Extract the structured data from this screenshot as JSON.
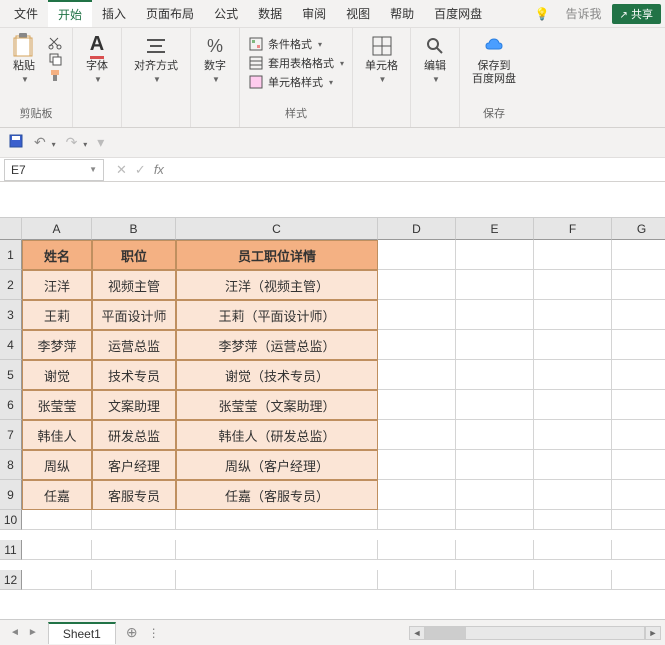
{
  "menu": {
    "file": "文件",
    "home": "开始",
    "insert": "插入",
    "layout": "页面布局",
    "formula": "公式",
    "data": "数据",
    "review": "审阅",
    "view": "视图",
    "help": "帮助",
    "baidu": "百度网盘",
    "tellme": "告诉我",
    "share": "共享"
  },
  "ribbon": {
    "clipboard": {
      "paste": "粘贴",
      "label": "剪贴板"
    },
    "font": {
      "btn": "字体"
    },
    "align": {
      "btn": "对齐方式"
    },
    "number": {
      "btn": "数字"
    },
    "styles": {
      "cond": "条件格式",
      "tbl": "套用表格格式",
      "cell": "单元格样式",
      "label": "样式"
    },
    "cells": {
      "btn": "单元格"
    },
    "editing": {
      "btn": "编辑"
    },
    "save": {
      "btn": "保存到\n百度网盘",
      "label": "保存"
    }
  },
  "namebox": "E7",
  "cols": [
    "A",
    "B",
    "C",
    "D",
    "E",
    "F",
    "G"
  ],
  "rows": [
    "1",
    "2",
    "3",
    "4",
    "5",
    "6",
    "7",
    "8",
    "9",
    "10",
    "11",
    "12"
  ],
  "header": {
    "a": "姓名",
    "b": "职位",
    "c": "员工职位详情"
  },
  "data": [
    {
      "a": "汪洋",
      "b": "视频主管",
      "c": "汪洋（视频主管）"
    },
    {
      "a": "王莉",
      "b": "平面设计师",
      "c": "王莉（平面设计师）"
    },
    {
      "a": "李梦萍",
      "b": "运营总监",
      "c": "李梦萍（运营总监）"
    },
    {
      "a": "谢觉",
      "b": "技术专员",
      "c": "谢觉（技术专员）"
    },
    {
      "a": "张莹莹",
      "b": "文案助理",
      "c": "张莹莹（文案助理）"
    },
    {
      "a": "韩佳人",
      "b": "研发总监",
      "c": "韩佳人（研发总监）"
    },
    {
      "a": "周纵",
      "b": "客户经理",
      "c": "周纵（客户经理）"
    },
    {
      "a": "任嘉",
      "b": "客服专员",
      "c": "任嘉（客服专员）"
    }
  ],
  "sheet": "Sheet1"
}
